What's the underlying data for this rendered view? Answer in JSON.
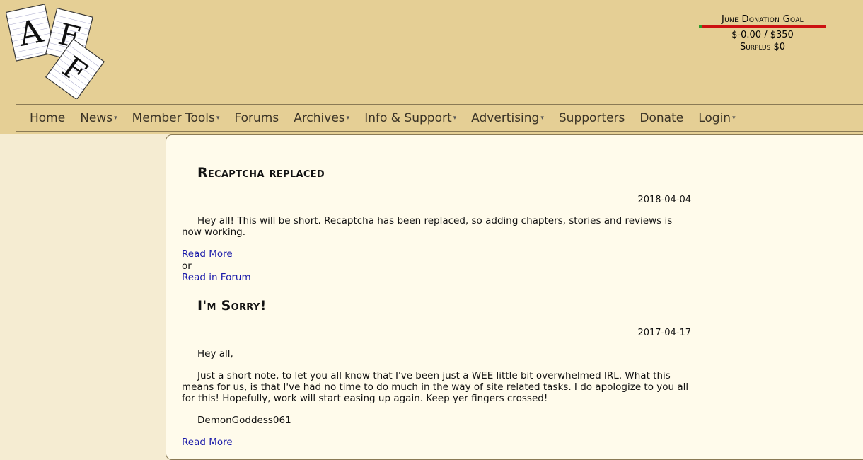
{
  "logo": {
    "letters": [
      "A",
      "F",
      "F"
    ]
  },
  "donation": {
    "title": "June Donation Goal",
    "amount": "$-0.00 / $350",
    "surplus": "Surplus $0",
    "progress": 0.0,
    "bar_color": "#cc1111",
    "fill_color": "#2a9a2a"
  },
  "nav": {
    "items": [
      {
        "label": "Home",
        "dropdown": false
      },
      {
        "label": "News",
        "dropdown": true
      },
      {
        "label": "Member Tools",
        "dropdown": true
      },
      {
        "label": "Forums",
        "dropdown": false
      },
      {
        "label": "Archives",
        "dropdown": true
      },
      {
        "label": "Info & Support",
        "dropdown": true
      },
      {
        "label": "Advertising",
        "dropdown": true
      },
      {
        "label": "Supporters",
        "dropdown": false
      },
      {
        "label": "Donate",
        "dropdown": false
      },
      {
        "label": "Login",
        "dropdown": true
      }
    ]
  },
  "posts": [
    {
      "title": "Recaptcha replaced",
      "date": "2018-04-04",
      "paragraphs": [
        "Hey all!  This will be short.  Recaptcha has been replaced, so adding chapters, stories and reviews is now working."
      ],
      "read_more": "Read More",
      "or": "or",
      "read_forum": "Read in Forum"
    },
    {
      "title": "I'm Sorry!",
      "date": "2017-04-17",
      "paragraphs": [
        "Hey all,",
        "Just a short note, to let you all know that I've been just a WEE little bit overwhelmed IRL.  What this means for us, is that I've had no time to do much in the way of site related tasks.  I do apologize to you all for this!  Hopefully, work will start easing up again.  Keep yer fingers crossed!",
        "DemonGoddess061"
      ],
      "read_more": "Read More"
    }
  ]
}
